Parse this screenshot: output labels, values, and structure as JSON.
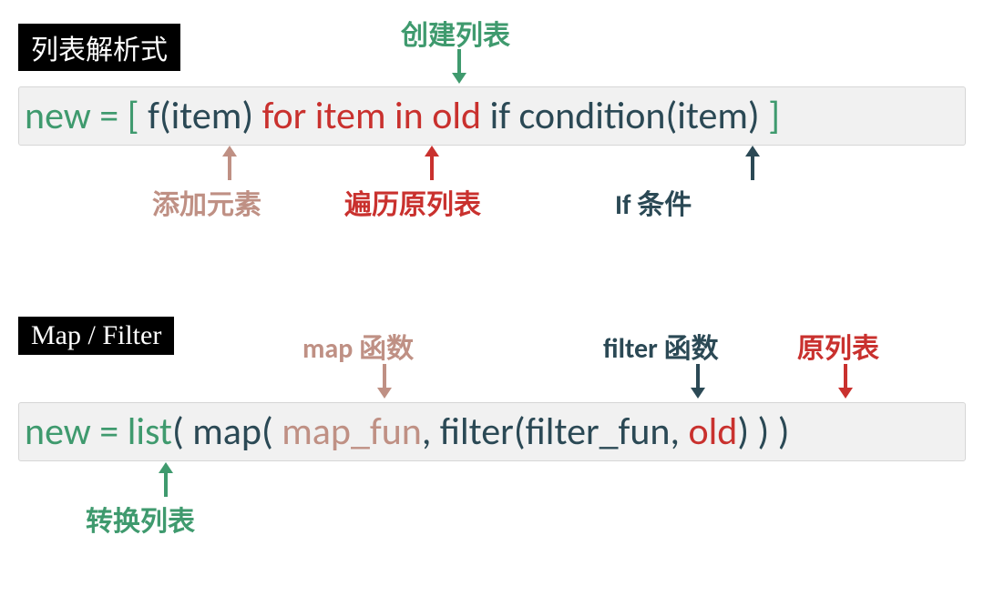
{
  "section1": {
    "tag": "列表解析式",
    "annot_top": "创建列表",
    "code": {
      "p1": "new = ",
      "p2": "[ ",
      "p3": "f(item) ",
      "p4": "for item in old ",
      "p5": "if condition(item) ",
      "p6": "]"
    },
    "annot_b1": "添加元素",
    "annot_b2": "遍历原列表",
    "annot_b3": "If 条件"
  },
  "section2": {
    "tag": "Map / Filter",
    "annot_t1": "map 函数",
    "annot_t2": "filter 函数",
    "annot_t3": "原列表",
    "code": {
      "p1": "new = ",
      "p2": "list",
      "p3": "( map( ",
      "p4": "map_fun",
      "p5": ", filter(",
      "p6": "filter_fun",
      "p7": ", ",
      "p8": "old",
      "p9": ") ) )"
    },
    "annot_b1": "转换列表"
  },
  "colors": {
    "green": "#3f9a6e",
    "dark": "#2b4955",
    "red": "#c9312e",
    "tan": "#bf9084"
  }
}
